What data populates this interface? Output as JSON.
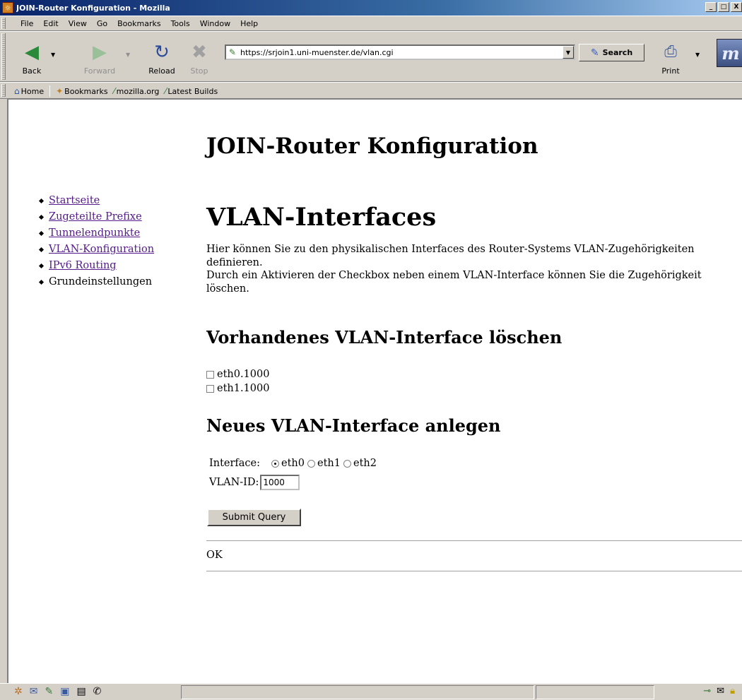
{
  "window": {
    "title": "JOIN-Router Konfiguration - Mozilla",
    "icon": "mozilla-app-icon",
    "minimize": "_",
    "maximize": "□",
    "close": "X"
  },
  "menu": [
    "File",
    "Edit",
    "View",
    "Go",
    "Bookmarks",
    "Tools",
    "Window",
    "Help"
  ],
  "toolbar": {
    "back": "Back",
    "forward": "Forward",
    "reload": "Reload",
    "stop": "Stop",
    "url": "https://srjoin1.uni-muenster.de/vlan.cgi",
    "search": "Search",
    "print": "Print"
  },
  "bookmarks": [
    "Home",
    "Bookmarks",
    "mozilla.org",
    "Latest Builds"
  ],
  "page": {
    "heading": "JOIN-Router Konfiguration",
    "nav": [
      {
        "label": "Startseite",
        "link": true
      },
      {
        "label": "Zugeteilte Prefixe",
        "link": true
      },
      {
        "label": "Tunnelendpunkte",
        "link": true
      },
      {
        "label": "VLAN-Konfiguration",
        "link": true
      },
      {
        "label": "IPv6 Routing",
        "link": true
      },
      {
        "label": "Grundeinstellungen",
        "link": false
      }
    ],
    "section_title": "VLAN-Interfaces",
    "intro1": "Hier können Sie zu den physikalischen Interfaces des Router-Systems VLAN-Zugehörigkeiten definieren.",
    "intro2": "Durch ein Aktivieren der Checkbox neben einem VLAN-Interface können Sie die Zugehörigkeit löschen.",
    "delete_heading": "Vorhandenes VLAN-Interface löschen",
    "existing": [
      {
        "label": "eth0.1000",
        "checked": false
      },
      {
        "label": "eth1.1000",
        "checked": false
      }
    ],
    "new_heading": "Neues VLAN-Interface anlegen",
    "interface_label": "Interface:",
    "interfaces": [
      {
        "label": "eth0",
        "selected": true
      },
      {
        "label": "eth1",
        "selected": false
      },
      {
        "label": "eth2",
        "selected": false
      }
    ],
    "vlan_label": "VLAN-ID:",
    "vlan_value": "1000",
    "submit": "Submit Query",
    "result": "OK"
  }
}
